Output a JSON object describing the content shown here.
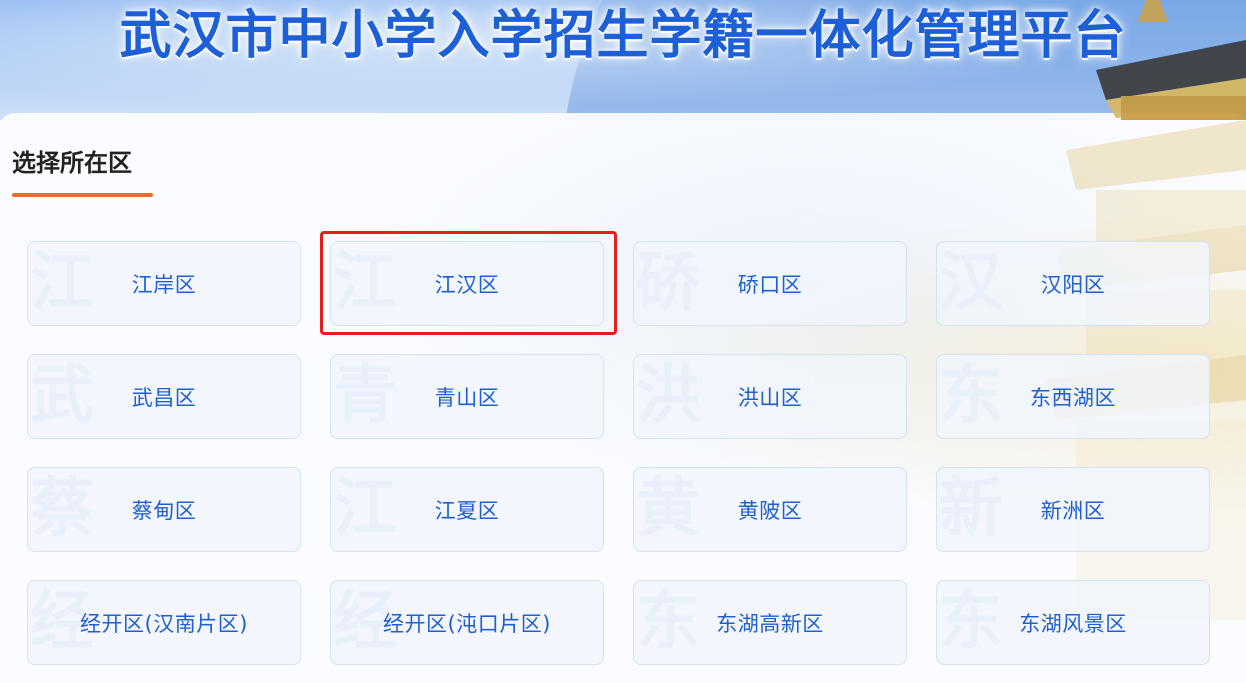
{
  "header": {
    "title": "武汉市中小学入学招生学籍一体化管理平台"
  },
  "section": {
    "title": "选择所在区"
  },
  "districts": [
    {
      "label": "江岸区",
      "watermark": "江"
    },
    {
      "label": "江汉区",
      "watermark": "江"
    },
    {
      "label": "硚口区",
      "watermark": "硚"
    },
    {
      "label": "汉阳区",
      "watermark": "汉"
    },
    {
      "label": "武昌区",
      "watermark": "武"
    },
    {
      "label": "青山区",
      "watermark": "青"
    },
    {
      "label": "洪山区",
      "watermark": "洪"
    },
    {
      "label": "东西湖区",
      "watermark": "东"
    },
    {
      "label": "蔡甸区",
      "watermark": "蔡"
    },
    {
      "label": "江夏区",
      "watermark": "江"
    },
    {
      "label": "黄陂区",
      "watermark": "黄"
    },
    {
      "label": "新洲区",
      "watermark": "新"
    },
    {
      "label": "经开区(汉南片区)",
      "watermark": "经"
    },
    {
      "label": "经开区(沌口片区)",
      "watermark": "经"
    },
    {
      "label": "东湖高新区",
      "watermark": "东"
    },
    {
      "label": "东湖风景区",
      "watermark": "东"
    }
  ],
  "selected_district": "江汉区",
  "colors": {
    "accent": "#f26b2a",
    "card_text": "#1f5fd0",
    "title_text": "#1d5fd6",
    "highlight_border": "#e0201d"
  }
}
